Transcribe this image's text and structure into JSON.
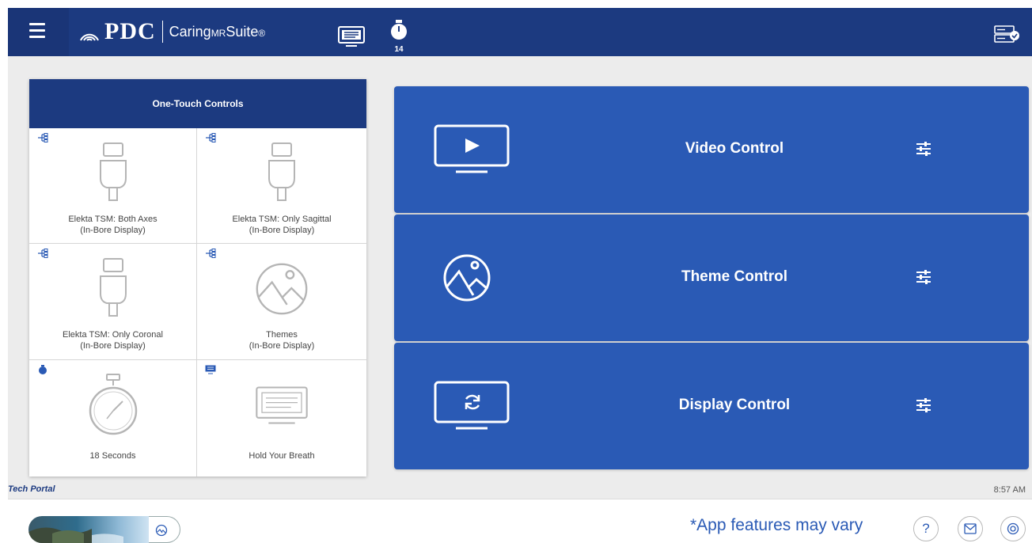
{
  "header": {
    "logo_text": "PDC",
    "suite_prefix": "Caring",
    "suite_mid": "MR",
    "suite_suffix": "Suite",
    "suite_mark": "®",
    "stopwatch_count": "14",
    "bar_color": "#1c3a80"
  },
  "one_touch": {
    "title": "One-Touch Controls",
    "cells": [
      {
        "label": "Elekta TSM: Both Axes\n(In-Bore Display)",
        "graphic": "usb-plug-icon",
        "badge": "tree-icon"
      },
      {
        "label": "Elekta TSM: Only Sagittal\n(In-Bore Display)",
        "graphic": "usb-plug-icon",
        "badge": "tree-icon"
      },
      {
        "label": "Elekta TSM: Only Coronal\n(In-Bore Display)",
        "graphic": "usb-plug-icon",
        "badge": "tree-icon"
      },
      {
        "label": "Themes\n(In-Bore Display)",
        "graphic": "landscape-icon",
        "badge": "tree-icon"
      },
      {
        "label": "18 Seconds",
        "graphic": "stopwatch-icon",
        "badge": "stopwatch-icon"
      },
      {
        "label": "Hold Your Breath",
        "graphic": "display-icon",
        "badge": "display-icon"
      }
    ]
  },
  "controls": [
    {
      "title": "Video Control",
      "icon": "video-play-icon"
    },
    {
      "title": "Theme Control",
      "icon": "landscape-icon"
    },
    {
      "title": "Display Control",
      "icon": "display-refresh-icon"
    }
  ],
  "footer": {
    "tech_portal": "Tech Portal",
    "time": "8:57 AM"
  },
  "bottom": {
    "features_note": "*App features may vary",
    "help_symbol": "?"
  },
  "colors": {
    "card_blue": "#2a5ab5",
    "header_navy": "#1c3a80",
    "background_grey": "#ececec"
  }
}
